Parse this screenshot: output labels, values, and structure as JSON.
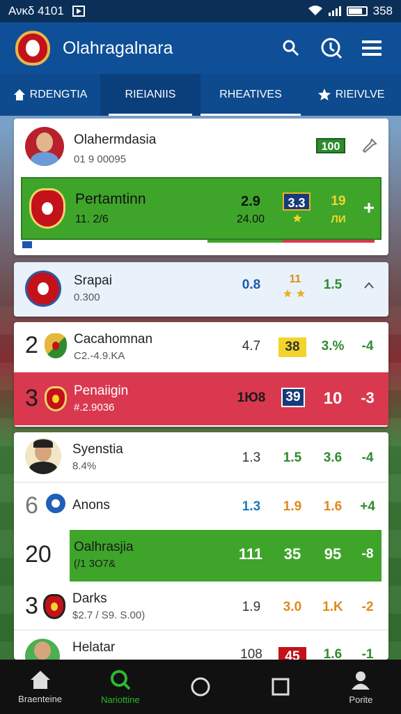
{
  "status": {
    "left_text": "Ανκδ 4101",
    "right_text": "358"
  },
  "app": {
    "title": "Olahragalnara"
  },
  "colors": {
    "appbar": "#0f4f97",
    "green": "#3ea52a",
    "red": "#d9384f",
    "yellow": "#f4d42a",
    "navy": "#173a7a"
  },
  "tabs": [
    {
      "label": "RDENGTIA",
      "icon": "home-icon"
    },
    {
      "label": "RIEIANIIS"
    },
    {
      "label": "RHEATIVES"
    },
    {
      "label": "RIEIVLVE",
      "icon": "star-icon"
    }
  ],
  "featured": {
    "player_name": "Olahermdasia",
    "player_sub": "01 9 00095",
    "badge": "100",
    "team_name": "Pertamtinn",
    "team_sub": "11. 2/6",
    "v1": "2.9",
    "v1_sub": "24.00",
    "v2": "3.3",
    "v3": "19",
    "v3_sub": "ЛИ"
  },
  "rows": [
    {
      "name": "Srapai",
      "sub": "0.300",
      "c1": "0.8",
      "c2": "11",
      "c3": "1.5"
    },
    {
      "rank": "2",
      "name": "Cacahomnan",
      "sub": "C2.-4.9.KA",
      "c1": "4.7",
      "c2": "38",
      "c3": "3.%",
      "c4": "-4"
    },
    {
      "rank": "3",
      "name": "Penaiigin",
      "sub": "#.2.9036",
      "c1": "1Ю8",
      "c2": "39",
      "c3": "10",
      "c4": "-3"
    },
    {
      "name": "Syenstia",
      "sub": "8.4%",
      "c1": "1.3",
      "c2": "1.5",
      "c3": "3.6",
      "c4": "-4"
    },
    {
      "rank": "6",
      "name": "Anons",
      "c1": "1.3",
      "c2": "1.9",
      "c3": "1.6",
      "c4": "+4"
    },
    {
      "rank": "20",
      "name": "Oalhrasjia",
      "sub": "(/1 3O7&",
      "c1": "111",
      "c2": "35",
      "c3": "95",
      "c4": "-8"
    },
    {
      "rank": "3",
      "name": "Darks",
      "sub": "$2.7 / S9. S.00)",
      "c1": "1.9",
      "c2": "3.0",
      "c3": "1.K",
      "c4": "-2"
    },
    {
      "name": "Helatar",
      "c1": "108",
      "c2": "45",
      "c3": "1.6",
      "c4": "-1"
    }
  ],
  "bottom_nav": [
    {
      "label": "Braenteine",
      "icon": "home-icon"
    },
    {
      "label": "Nariottine",
      "icon": "search-icon"
    },
    {
      "label": "",
      "icon": "circle-icon"
    },
    {
      "label": "",
      "icon": "square-icon"
    },
    {
      "label": "Porite",
      "icon": "person-icon"
    }
  ]
}
